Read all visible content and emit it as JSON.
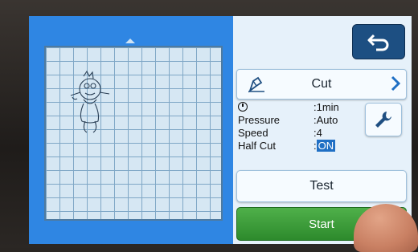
{
  "mode": {
    "label": "Cut"
  },
  "settings": {
    "time_value": ":1min",
    "pressure_label": "Pressure",
    "pressure_value": ":Auto",
    "speed_label": "Speed",
    "speed_value": ":4",
    "halfcut_label": "Half Cut",
    "halfcut_prefix": ":",
    "halfcut_value": "ON"
  },
  "buttons": {
    "test_label": "Test",
    "start_label": "Start"
  },
  "icons": {
    "back": "back-arrow-icon",
    "mode": "pen-icon",
    "next": "chevron-right-icon",
    "time": "clock-icon",
    "settings": "wrench-icon"
  },
  "colors": {
    "screen_blue": "#2f86e3",
    "panel_bg": "#e6f1fa",
    "start_green": "#2d8a2c",
    "highlight": "#1f6fc4"
  }
}
